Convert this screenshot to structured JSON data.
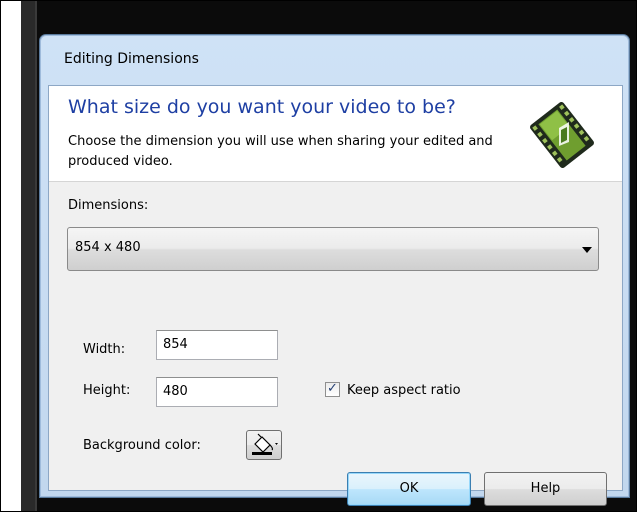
{
  "dialog": {
    "title": "Editing Dimensions",
    "heading": "What size do you want your video to be?",
    "description": "Choose the dimension you will use when sharing your edited and produced video.",
    "icon": "video-filmstrip-icon"
  },
  "dimensions": {
    "label": "Dimensions:",
    "selected": "854 x 480"
  },
  "width": {
    "label": "Width:",
    "value": "854"
  },
  "height": {
    "label": "Height:",
    "value": "480"
  },
  "keep_aspect_ratio": {
    "label": "Keep aspect ratio",
    "checked": true
  },
  "background_color": {
    "label": "Background color:",
    "icon": "paint-bucket-icon"
  },
  "buttons": {
    "ok": "OK",
    "help": "Help"
  },
  "colors": {
    "heading": "#1e3fa3",
    "dialog_frame": "#cfe2f6",
    "ok_button": "#bee6fd"
  }
}
